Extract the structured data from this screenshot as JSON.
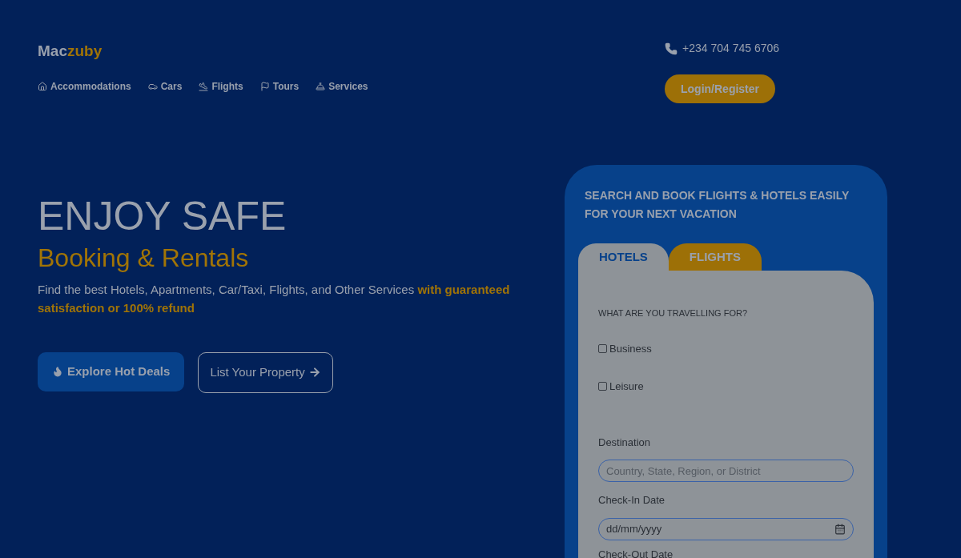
{
  "brand": {
    "part_1": "Mac",
    "part_2": "zuby"
  },
  "nav": [
    {
      "kind": "home",
      "label": "Accommodations"
    },
    {
      "kind": "car",
      "label": "Cars"
    },
    {
      "kind": "plane",
      "label": "Flights"
    },
    {
      "kind": "flag",
      "label": "Tours"
    },
    {
      "kind": "bell",
      "label": "Services"
    }
  ],
  "phone": "+234 704 745 6706",
  "login_button": "Login/Register",
  "hero": {
    "title": "ENJOY SAFE",
    "subtitle": "Booking & Rentals",
    "text": "Find the best Hotels, Apartments, Car/Taxi, Flights, and Other Services **with guaranteed satisfaction or 100% refund**",
    "primary_button": "Explore Hot Deals",
    "secondary_button": "List Your Property"
  },
  "search_card": {
    "heading": "SEARCH AND BOOK FLIGHTS & HOTELS EASILY FOR YOUR NEXT VACATION",
    "tabs": [
      {
        "label": "HOTELS",
        "selected": true
      },
      {
        "label": "FLIGHTS",
        "selected": false
      }
    ],
    "purpose_label": "WHAT ARE YOU TRAVELLING FOR?",
    "purposes": [
      {
        "label": "Business",
        "checked": false
      },
      {
        "label": "Leisure",
        "checked": false
      }
    ],
    "destination": {
      "label": "Destination",
      "placeholder": "Country, State, Region, or District"
    },
    "check_in": {
      "label": "Check-In Date",
      "value": "dd/mm/yyyy"
    },
    "check_out": {
      "label": "Check-Out Date"
    }
  }
}
